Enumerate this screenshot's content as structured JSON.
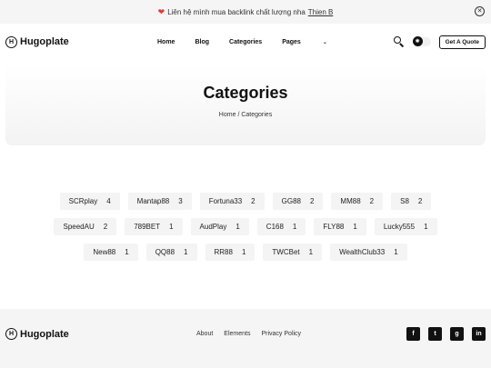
{
  "announcement": {
    "text": "Liên hệ mình mua backlink chất lượng nha",
    "link": "Thien B"
  },
  "brand": {
    "logo_letter": "H",
    "name": "Hugoplate"
  },
  "nav": {
    "items": [
      "Home",
      "Blog",
      "Categories",
      "Pages"
    ],
    "pages_chevron": "⌄"
  },
  "header": {
    "quote_button": "Get A Quote"
  },
  "hero": {
    "title": "Categories",
    "breadcrumb_home": "Home",
    "breadcrumb_sep": "/",
    "breadcrumb_current": "Categories"
  },
  "categories": [
    {
      "name": "SCRplay",
      "count": "4"
    },
    {
      "name": "Mantap88",
      "count": "3"
    },
    {
      "name": "Fortuna33",
      "count": "2"
    },
    {
      "name": "GG88",
      "count": "2"
    },
    {
      "name": "MM88",
      "count": "2"
    },
    {
      "name": "S8",
      "count": "2"
    },
    {
      "name": "SpeedAU",
      "count": "2"
    },
    {
      "name": "789BET",
      "count": "1"
    },
    {
      "name": "AudPlay",
      "count": "1"
    },
    {
      "name": "C168",
      "count": "1"
    },
    {
      "name": "FLY88",
      "count": "1"
    },
    {
      "name": "Lucky555",
      "count": "1"
    },
    {
      "name": "New88",
      "count": "1"
    },
    {
      "name": "QQ88",
      "count": "1"
    },
    {
      "name": "RR88",
      "count": "1"
    },
    {
      "name": "TWCBet",
      "count": "1"
    },
    {
      "name": "WealthClub33",
      "count": "1"
    }
  ],
  "footer": {
    "links": [
      "About",
      "Elements",
      "Privacy Policy"
    ],
    "socials": [
      {
        "icon": "facebook-icon",
        "glyph": "f"
      },
      {
        "icon": "twitter-icon",
        "glyph": "t"
      },
      {
        "icon": "github-icon",
        "glyph": "g"
      },
      {
        "icon": "linkedin-icon",
        "glyph": "in"
      }
    ]
  },
  "colors": {
    "accent": "#111111",
    "heart": "#e53935",
    "chip_bg": "#f4f4f4"
  }
}
